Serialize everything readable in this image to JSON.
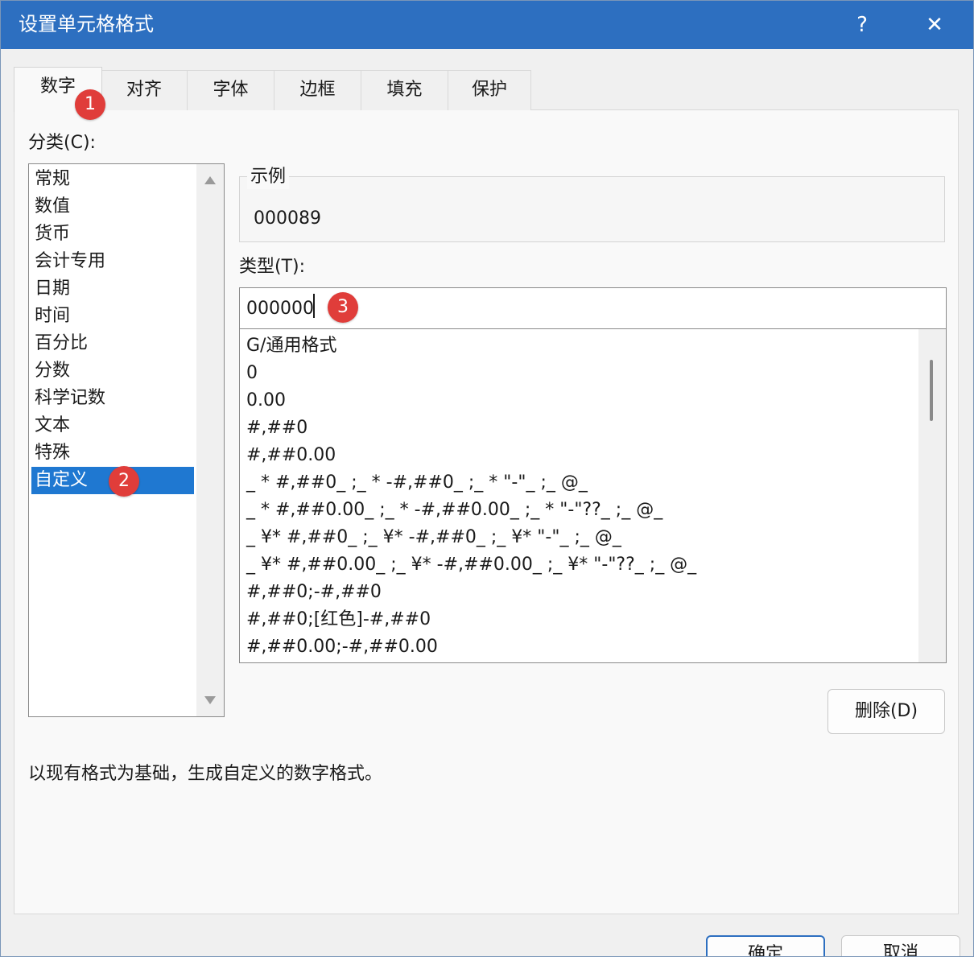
{
  "dialog": {
    "title": "设置单元格格式",
    "help_label": "?",
    "close_label": "✕"
  },
  "tabs": [
    {
      "label": "数字"
    },
    {
      "label": "对齐"
    },
    {
      "label": "字体"
    },
    {
      "label": "边框"
    },
    {
      "label": "填充"
    },
    {
      "label": "保护"
    }
  ],
  "category": {
    "label": "分类(C):",
    "items": [
      "常规",
      "数值",
      "货币",
      "会计专用",
      "日期",
      "时间",
      "百分比",
      "分数",
      "科学记数",
      "文本",
      "特殊",
      "自定义"
    ],
    "selected": "自定义"
  },
  "sample": {
    "label": "示例",
    "value": "000089"
  },
  "type": {
    "label": "类型(T):",
    "value": "000000"
  },
  "formats": [
    "G/通用格式",
    "0",
    "0.00",
    "#,##0",
    "#,##0.00",
    "_ * #,##0_ ;_ * -#,##0_ ;_ * \"-\"_ ;_ @_",
    "_ * #,##0.00_ ;_ * -#,##0.00_ ;_ * \"-\"??_ ;_ @_",
    "_ ¥* #,##0_ ;_ ¥* -#,##0_ ;_ ¥* \"-\"_ ;_ @_",
    "_ ¥* #,##0.00_ ;_ ¥* -#,##0.00_ ;_ ¥* \"-\"??_ ;_ @_",
    "#,##0;-#,##0",
    "#,##0;[红色]-#,##0",
    "#,##0.00;-#,##0.00"
  ],
  "buttons": {
    "delete": "删除(D)",
    "ok": "确定",
    "cancel": "取消"
  },
  "description": "以现有格式为基础，生成自定义的数字格式。",
  "annotations": [
    "1",
    "2",
    "3"
  ],
  "colors": {
    "title_bar": "#2d6fc0",
    "selection": "#1f78d1",
    "badge": "#e03d3a"
  }
}
